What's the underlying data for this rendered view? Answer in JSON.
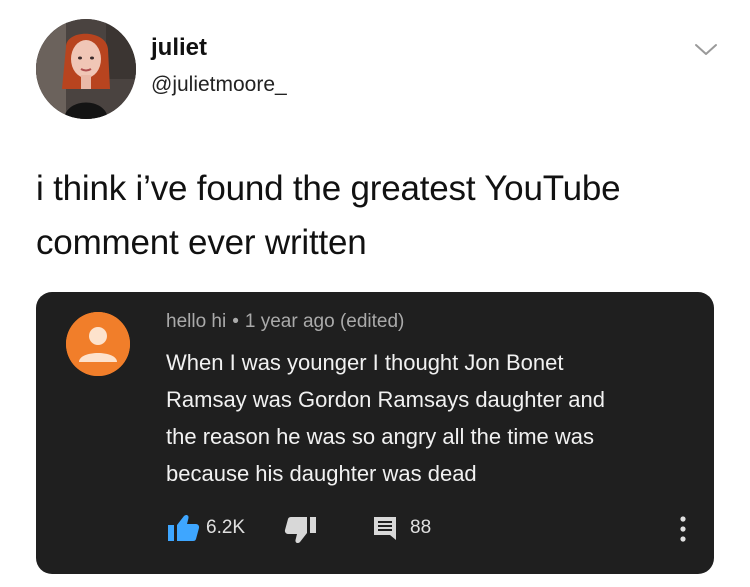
{
  "tweet": {
    "display_name": "juliet",
    "handle": "@julietmoore_",
    "text_lines": [
      "i think i’ve found the greatest YouTube",
      "comment ever written"
    ]
  },
  "youtube_comment": {
    "author": "hello hi",
    "separator": "•",
    "timestamp": "1 year ago (edited)",
    "body_lines": [
      "When I was younger I thought Jon Bonet",
      "Ramsay was Gordon Ramsays daughter and",
      "the reason he was so angry all the time was",
      "because his daughter was dead"
    ],
    "likes": "6.2K",
    "replies": "88"
  },
  "icons": {
    "caret": "chevron-down-icon",
    "like": "thumbs-up-icon",
    "dislike": "thumbs-down-icon",
    "reply": "comment-icon",
    "more": "more-vertical-icon"
  },
  "colors": {
    "card_background": "#1f1f1f",
    "like_active": "#3ea6ff",
    "default_avatar": "#f17e2a"
  }
}
